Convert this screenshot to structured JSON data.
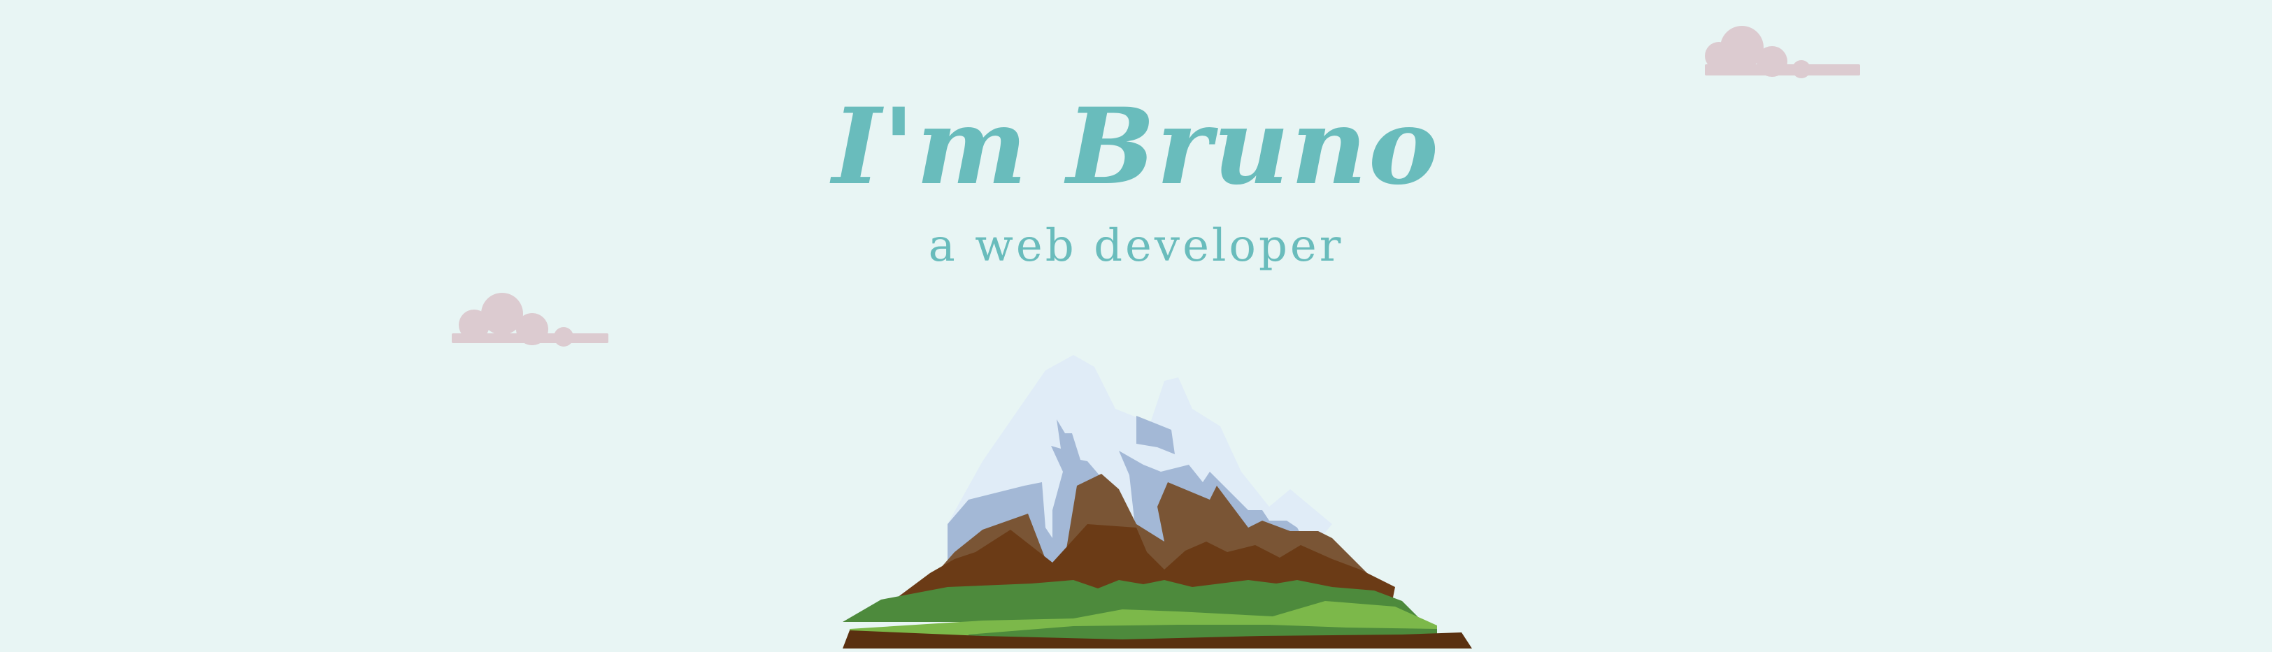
{
  "hero": {
    "title": "I'm Bruno",
    "subtitle": "a web developer"
  },
  "illustration": {
    "name": "snow-capped-mountain",
    "clouds": 2
  },
  "colors": {
    "background": "#e8f5f4",
    "text": "#69bcbc",
    "cloud": "#dccbd0",
    "snow": "#e0ecf7",
    "snow_shadow": "#a3b8d6",
    "rock_light": "#7a5535",
    "rock_dark": "#6b3b16",
    "grass_dark": "#4d8a3c",
    "grass_light": "#7cb84a",
    "soil": "#5a3010"
  }
}
